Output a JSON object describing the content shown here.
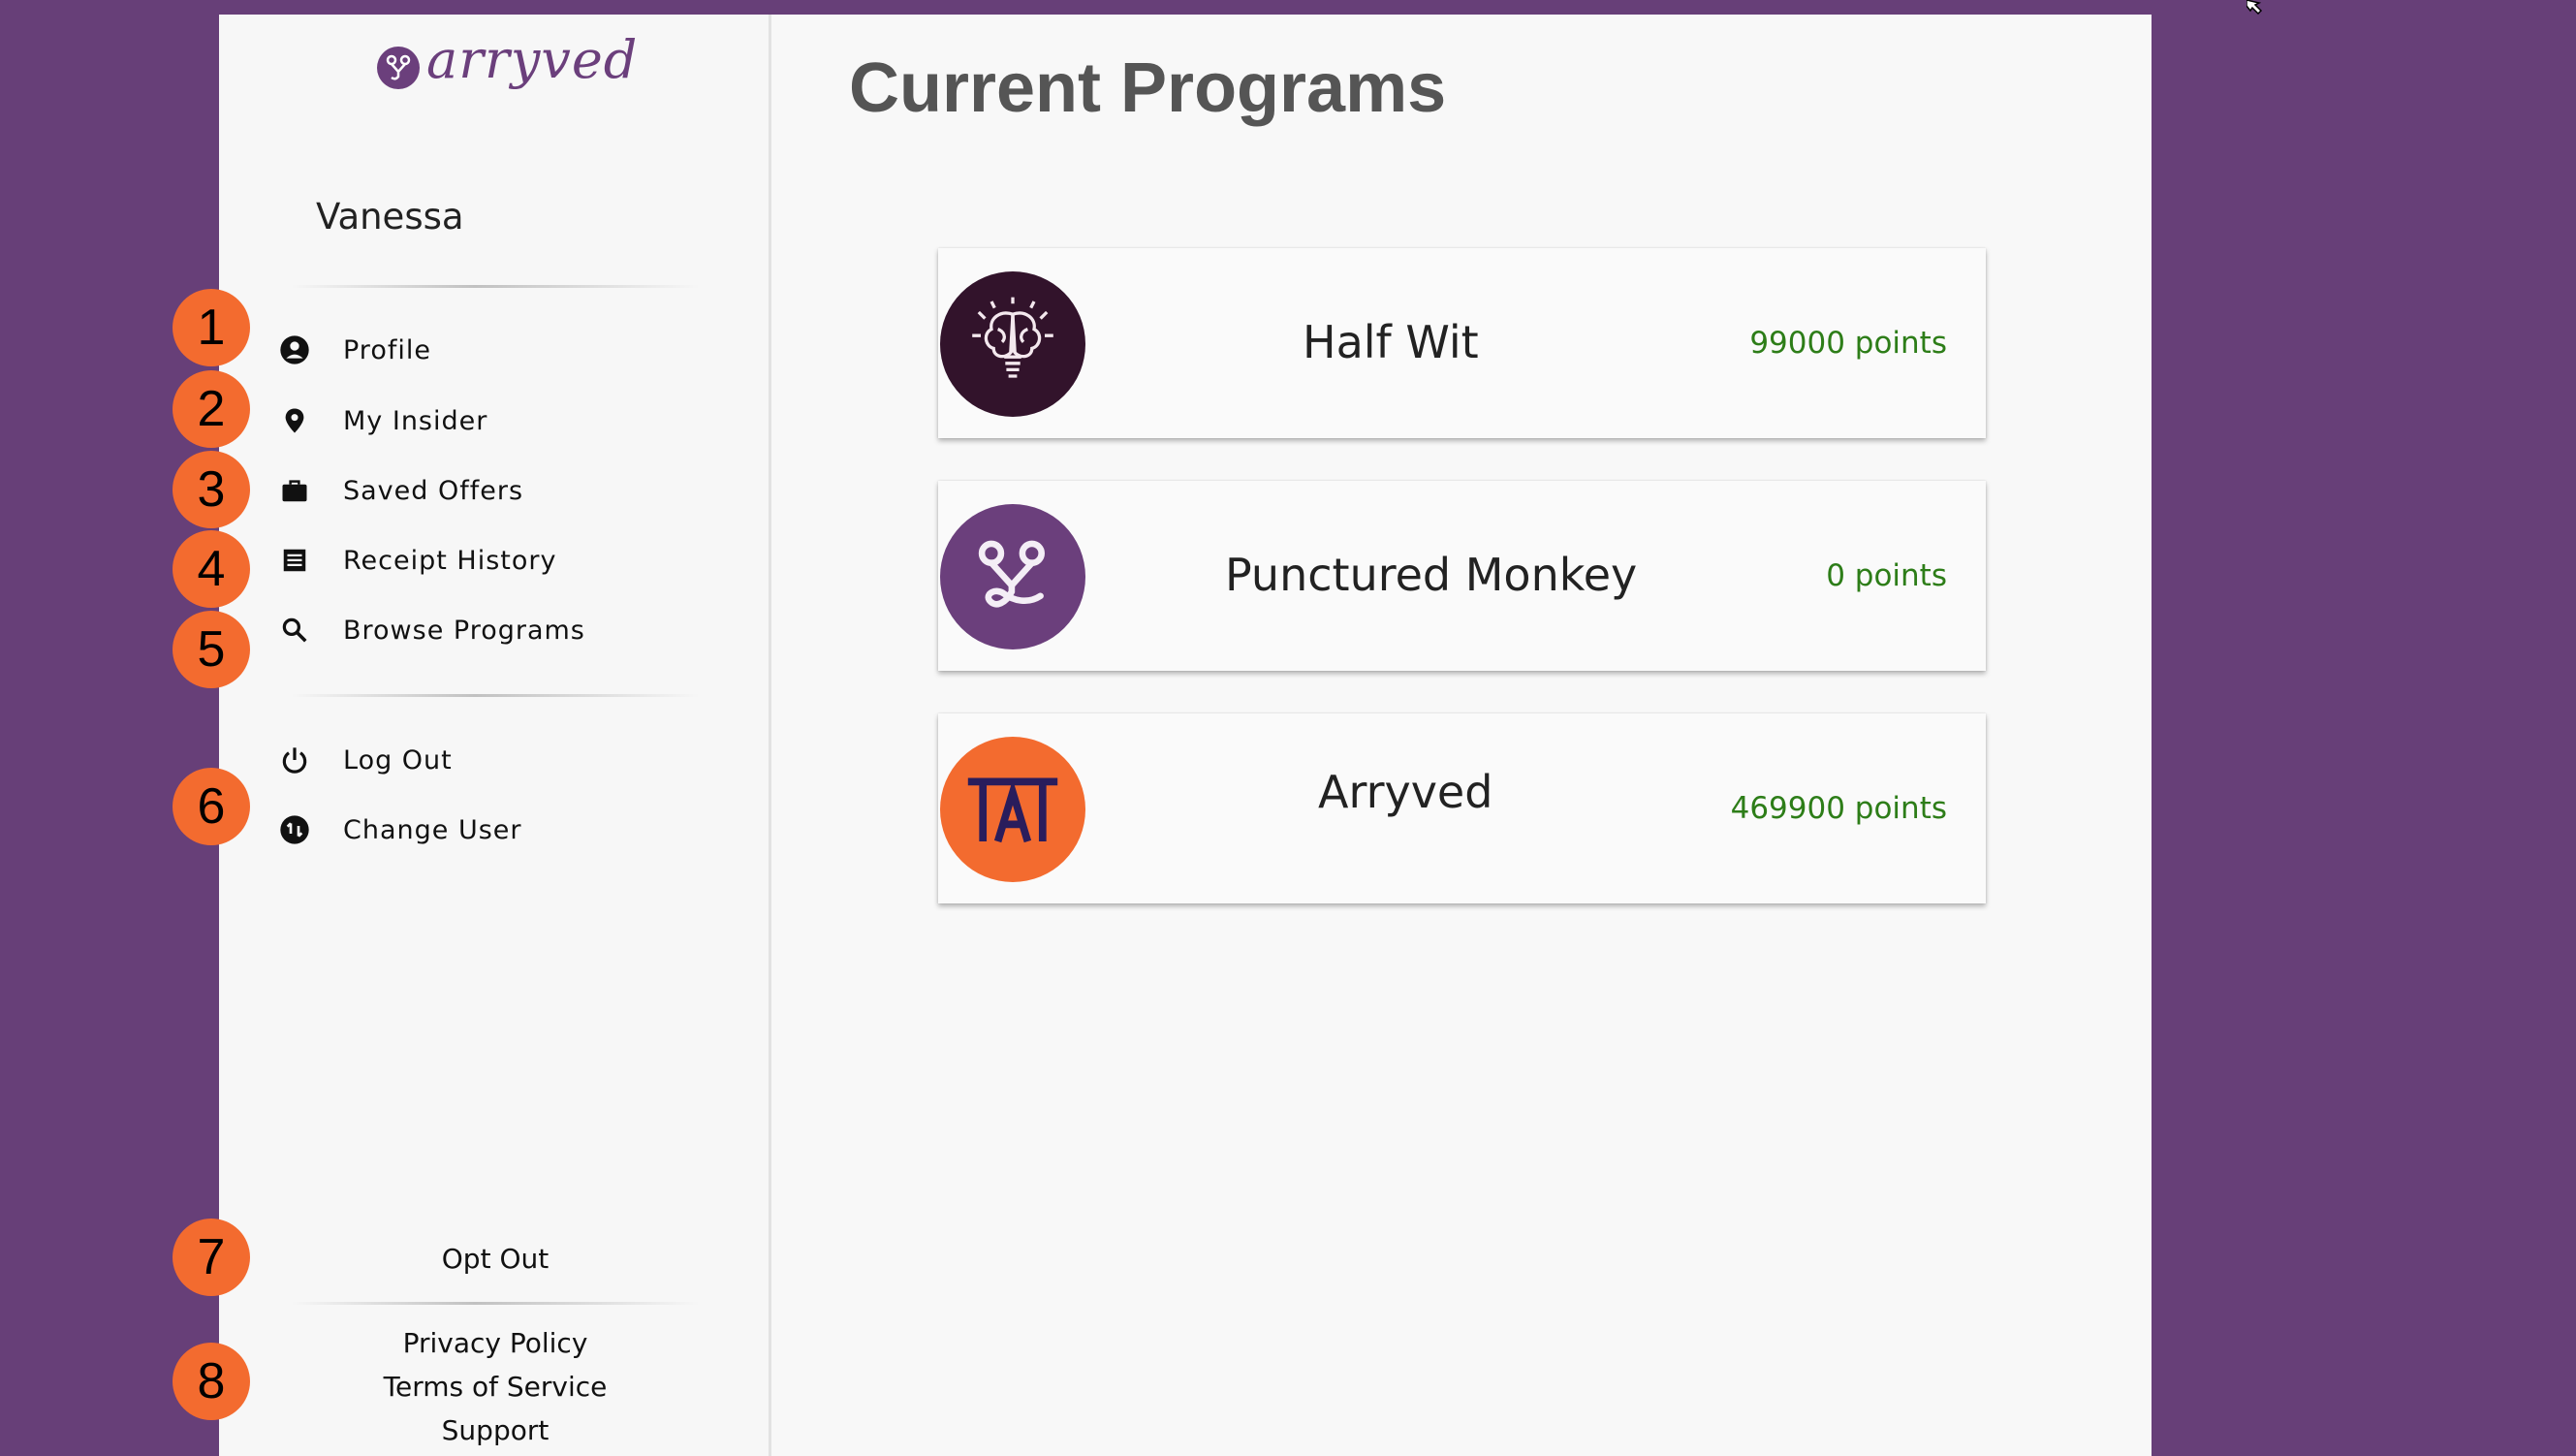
{
  "brand": {
    "name": "arryved"
  },
  "user": {
    "name": "Vanessa"
  },
  "sidebar": {
    "items": [
      {
        "label": "Profile",
        "icon": "account-circle-icon"
      },
      {
        "label": "My Insider",
        "icon": "location-pin-icon"
      },
      {
        "label": "Saved Offers",
        "icon": "briefcase-icon"
      },
      {
        "label": "Receipt History",
        "icon": "receipt-icon"
      },
      {
        "label": "Browse Programs",
        "icon": "search-icon"
      }
    ],
    "session_items": [
      {
        "label": "Log Out",
        "icon": "power-icon"
      },
      {
        "label": "Change User",
        "icon": "switch-user-icon"
      }
    ],
    "opt_out": "Opt Out",
    "footer_links": [
      "Privacy Policy",
      "Terms of Service",
      "Support"
    ]
  },
  "annotations": [
    "1",
    "2",
    "3",
    "4",
    "5",
    "6",
    "7",
    "8"
  ],
  "main": {
    "title": "Current Programs",
    "programs": [
      {
        "name": "Half Wit",
        "points": "99000 points",
        "icon": "brain-lightbulb-icon",
        "color": "#32132b"
      },
      {
        "name": "Punctured Monkey",
        "points": "0 points",
        "icon": "arryved-logo-icon",
        "color": "#6b3f7c"
      },
      {
        "name": "Arryved",
        "points": "469900 points",
        "icon": "tat-logo-icon",
        "color": "#f36b2f"
      }
    ]
  },
  "colors": {
    "background": "#673f78",
    "panel": "#f8f8f8",
    "accent": "#6b3f7c",
    "badge": "#f36b2f",
    "points": "#2d7d18"
  }
}
